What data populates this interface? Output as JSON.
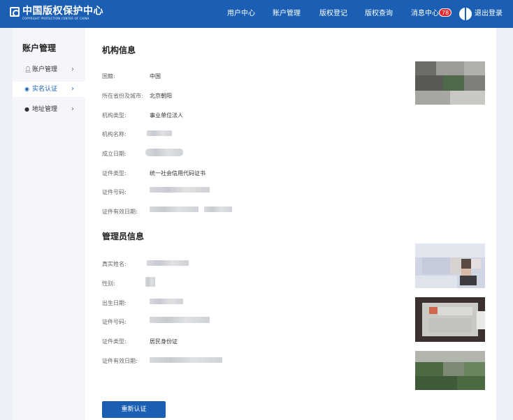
{
  "header": {
    "logo_cn": "中国版权保护中心",
    "logo_en": "COPYRIGHT PROTECTION CENTER OF CHINA",
    "nav": [
      "用户中心",
      "账户管理",
      "版权登记",
      "版权查询"
    ],
    "messages_label": "消息中心",
    "messages_count": "78",
    "logout_label": "退出登录"
  },
  "sidebar": {
    "title": "账户管理",
    "items": [
      {
        "label": "账户管理",
        "icon": "user-icon"
      },
      {
        "label": "实名认证",
        "icon": "verified-icon"
      },
      {
        "label": "地址管理",
        "icon": "location-pin-icon"
      }
    ]
  },
  "org": {
    "title": "机构信息",
    "fields": [
      {
        "label": "国籍:",
        "value": "中国"
      },
      {
        "label": "所在省份及城市:",
        "value": "北京朝阳"
      },
      {
        "label": "机构类型:",
        "value": "事业单位法人"
      },
      {
        "label": "机构名称:",
        "value": ""
      },
      {
        "label": "成立日期:",
        "value": ""
      },
      {
        "label": "证件类型:",
        "value": "统一社会信用代码证书"
      },
      {
        "label": "证件号码:",
        "value": ""
      },
      {
        "label": "证件有效日期:",
        "value": ""
      }
    ]
  },
  "admin": {
    "title": "管理员信息",
    "fields": [
      {
        "label": "真实姓名:",
        "value": ""
      },
      {
        "label": "性别:",
        "value": ""
      },
      {
        "label": "出生日期:",
        "value": ""
      },
      {
        "label": "证件号码:",
        "value": ""
      },
      {
        "label": "证件类型:",
        "value": "居民身份证"
      },
      {
        "label": "证件有效日期:",
        "value": ""
      }
    ]
  },
  "actions": {
    "reverify_label": "重新认证"
  },
  "colors": {
    "primary": "#1a5fb4",
    "badge": "#e4272d"
  }
}
